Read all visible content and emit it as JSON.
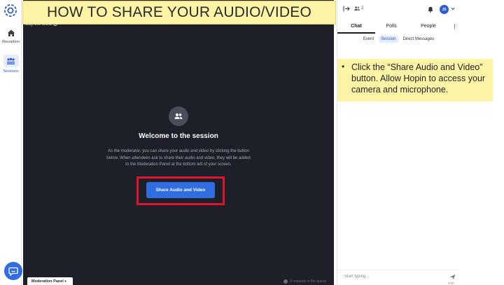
{
  "banner": {
    "title": "HOW TO SHARE YOUR AUDIO/VIDEO"
  },
  "nav": {
    "logo_icon": "hopin-logo-icon",
    "items": [
      {
        "label": "Reception",
        "icon": "home-icon"
      },
      {
        "label": "Sessions",
        "icon": "sessions-icon",
        "active": true
      }
    ],
    "chat_fab_icon": "chat-bubble-icon"
  },
  "stage": {
    "session_title": "Say the word",
    "welcome_title": "Welcome to the session",
    "welcome_text": "As the moderator, you can share your audio and video by clicking the button below. When attendees ask to share their audio and video, they will be added to the Moderation Panel at the bottom left of your screen.",
    "share_button": "Share Audio and Video",
    "moderation_panel": "Moderation Panel",
    "queue_text": "0 requests in the queue"
  },
  "right_panel": {
    "attendee_count": "2",
    "user_initials": "JS",
    "tabs": [
      "Chat",
      "Polls",
      "People"
    ],
    "more_icon": "more-vertical-icon",
    "subtabs": [
      "Event",
      "Session",
      "Direct Messages"
    ],
    "active_subtab": "Session",
    "message_placeholder": "Start typing...",
    "char_count": "0/30"
  },
  "note": {
    "text": "Click the “Share Audio and Video” button.  Allow Hopin to access your camera and microphone."
  },
  "colors": {
    "accent": "#2f6de0",
    "stage_bg": "#1d2029",
    "banner_bg": "#fdf5a5",
    "highlight": "#e3122b"
  }
}
